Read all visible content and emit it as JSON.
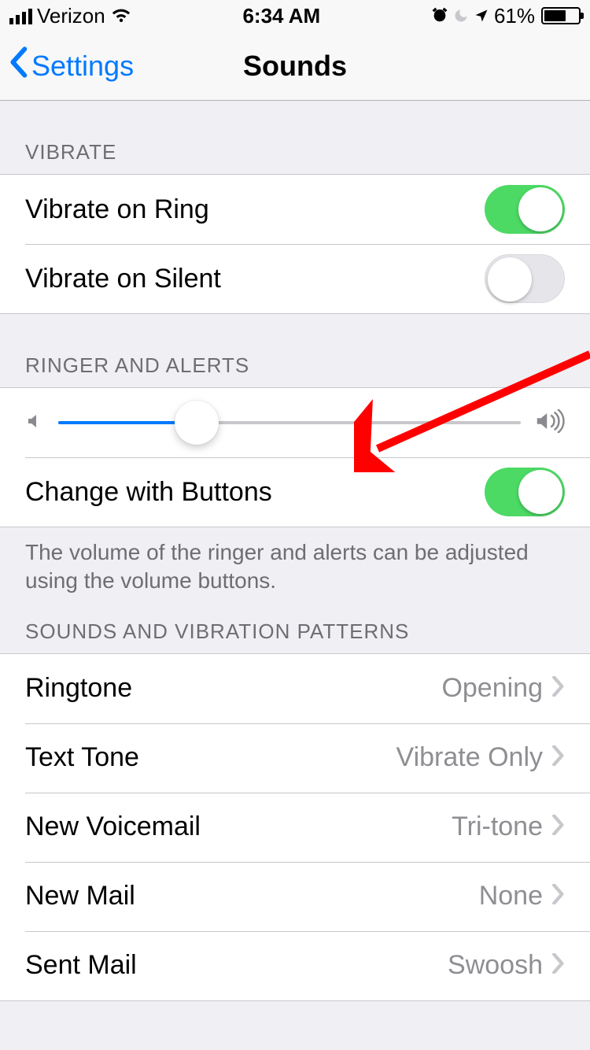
{
  "statusbar": {
    "carrier": "Verizon",
    "time": "6:34 AM",
    "battery_pct": "61%"
  },
  "nav": {
    "back_label": "Settings",
    "title": "Sounds"
  },
  "sections": {
    "vibrate_header": "VIBRATE",
    "vibrate": {
      "on_ring": {
        "label": "Vibrate on Ring",
        "on": true
      },
      "on_silent": {
        "label": "Vibrate on Silent",
        "on": false
      }
    },
    "ringer_header": "RINGER AND ALERTS",
    "ringer": {
      "slider_pct": 30,
      "change_buttons": {
        "label": "Change with Buttons",
        "on": true
      },
      "footer": "The volume of the ringer and alerts can be adjusted using the volume buttons."
    },
    "sounds_header": "SOUNDS AND VIBRATION PATTERNS",
    "sounds": [
      {
        "label": "Ringtone",
        "value": "Opening"
      },
      {
        "label": "Text Tone",
        "value": "Vibrate Only"
      },
      {
        "label": "New Voicemail",
        "value": "Tri-tone"
      },
      {
        "label": "New Mail",
        "value": "None"
      },
      {
        "label": "Sent Mail",
        "value": "Swoosh"
      }
    ]
  }
}
